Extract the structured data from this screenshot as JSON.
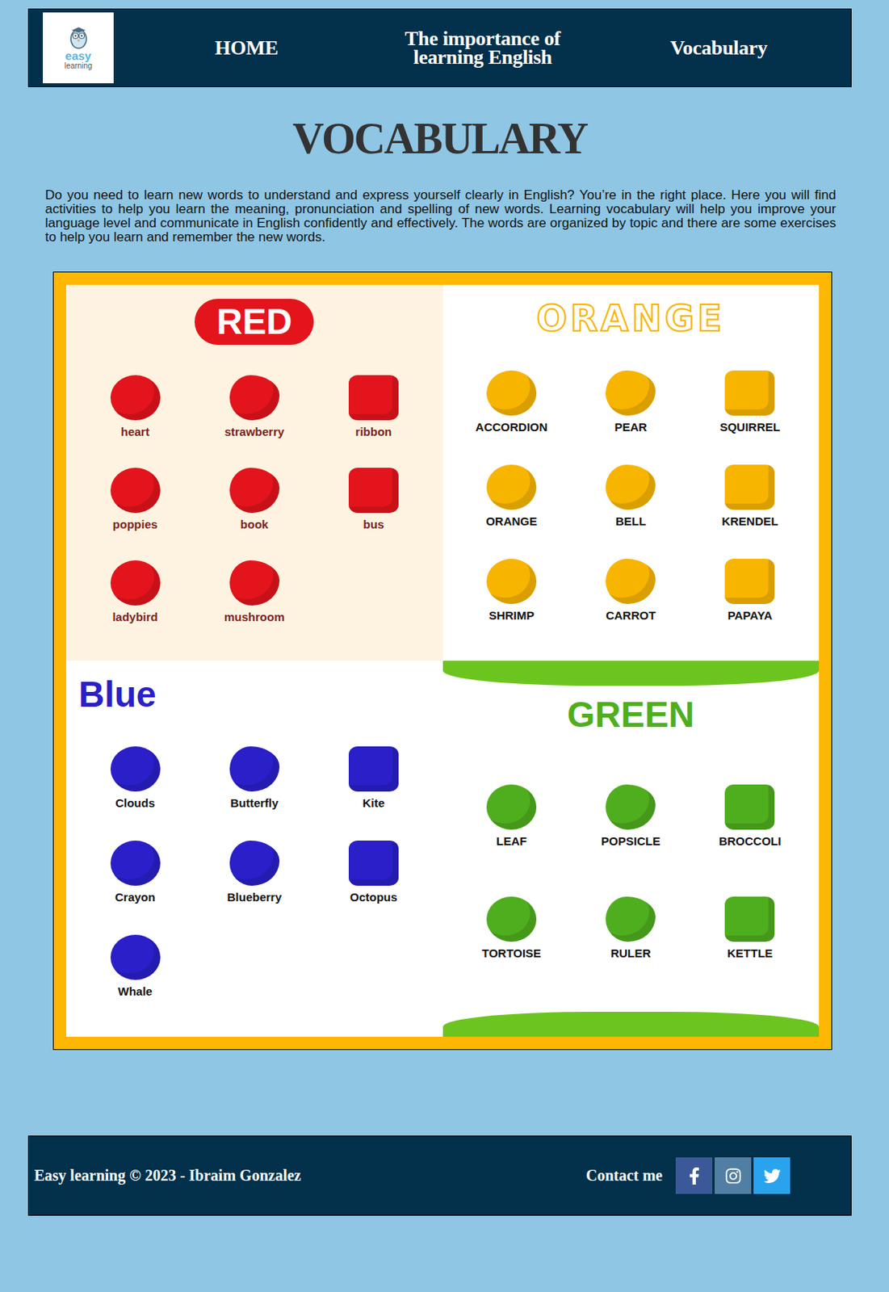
{
  "nav": {
    "logo": {
      "top": "easy",
      "bottom": "learning"
    },
    "links": [
      {
        "label": "HOME"
      },
      {
        "label": "The importance of learning English"
      },
      {
        "label": "Vocabulary"
      }
    ]
  },
  "page": {
    "title": "VOCABULARY",
    "intro": "Do you need to learn new words to understand and express yourself clearly in English? You’re in the right place. Here you will find activities to help you learn the meaning, pronunciation and spelling of new words. Learning vocabulary will help you improve your language level and communicate in English confidently and effectively. The words are organized by topic and there are some exercises to help you learn and remember the new words."
  },
  "poster": {
    "panels": [
      {
        "title": "RED",
        "kind": "pill",
        "color": "#e3141c",
        "background": "#fdf3e0",
        "label_color": "#7a1f1f",
        "items": [
          "heart",
          "strawberry",
          "ribbon",
          "poppies",
          "book",
          "bus",
          "ladybird",
          "mushroom"
        ]
      },
      {
        "title": "ORANGE",
        "kind": "outline",
        "color": "#f7b500",
        "background": "#ffffff",
        "label_color": "#111111",
        "items": [
          "ACCORDION",
          "PEAR",
          "SQUIRREL",
          "ORANGE",
          "BELL",
          "KRENDEL",
          "SHRIMP",
          "CARROT",
          "PAPAYA"
        ]
      },
      {
        "title": "Blue",
        "kind": "plain",
        "color": "#2a1fc8",
        "background": "#ffffff",
        "label_color": "#111111",
        "items": [
          "Clouds",
          "Butterfly",
          "Kite",
          "Crayon",
          "Blueberry",
          "Octopus",
          "Whale"
        ]
      },
      {
        "title": "GREEN",
        "kind": "banded",
        "color": "#4fae1e",
        "background": "#ffffff",
        "label_color": "#111111",
        "items": [
          "LEAF",
          "POPSICLE",
          "BROCCOLI",
          "TORTOISE",
          "RULER",
          "KETTLE"
        ]
      }
    ]
  },
  "footer": {
    "credit": "Easy learning © 2023 - Ibraim Gonzalez",
    "contact_label": "Contact me",
    "socials": [
      {
        "kind": "facebook",
        "color": "#3b5998"
      },
      {
        "kind": "instagram",
        "color": "#517fa4"
      },
      {
        "kind": "twitter",
        "color": "#2aa3ef"
      }
    ]
  }
}
